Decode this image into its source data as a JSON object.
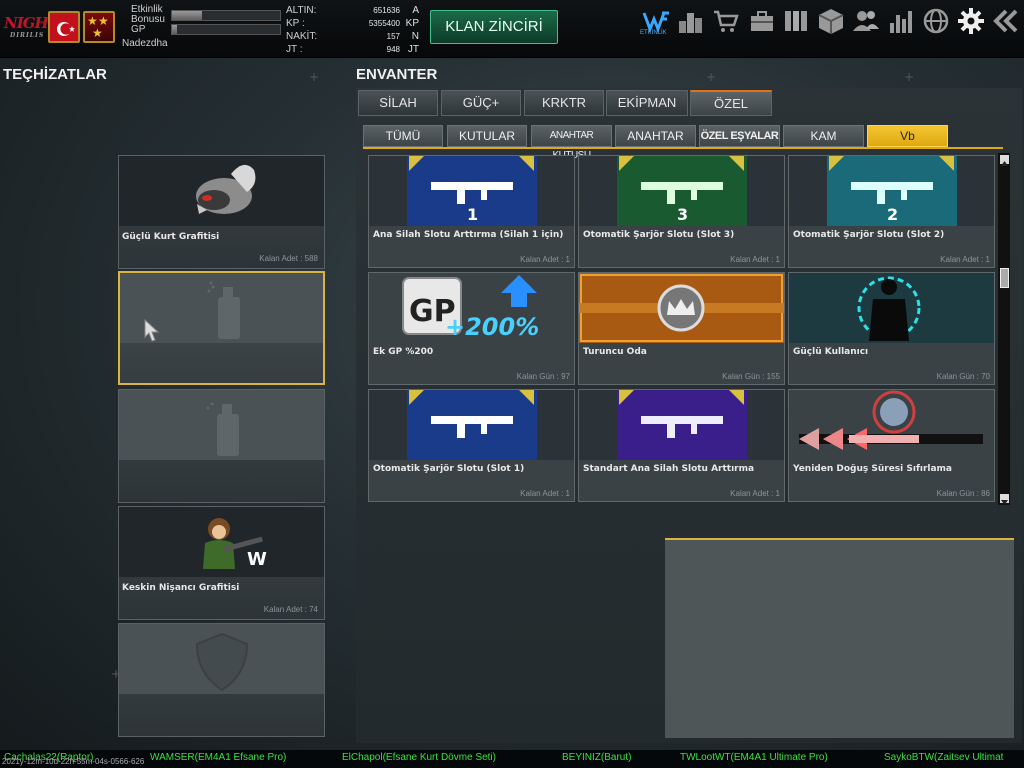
{
  "header": {
    "logo_text": "NIGHT",
    "logo_sub": "DIRILIS",
    "event_bonus_label": "Etkinlik Bonusu",
    "gp_label": "GP",
    "event_bonus_progress": 0.28,
    "gp_progress": 0.05,
    "nickname": "Nadezdha",
    "currency": [
      {
        "name": "ALTIN:",
        "value": "651636",
        "unit": "A"
      },
      {
        "name": "KP  :",
        "value": "5355400",
        "unit": "KP"
      },
      {
        "name": "NAKİT:",
        "value": "157",
        "unit": "N"
      },
      {
        "name": "JT   :",
        "value": "948",
        "unit": "JT"
      }
    ],
    "klan_button": "KLAN ZİNCİRİ",
    "event_icon_label": "ETKİNLİK",
    "icons": [
      "event-icon",
      "ranking-icon",
      "shop-cart-icon",
      "briefcase-icon",
      "cards-icon",
      "box-icon",
      "users-icon",
      "stats-icon",
      "globe-icon",
      "settings-icon",
      "back-icon"
    ]
  },
  "left_panel": {
    "title": "TEÇHİZATLAR",
    "slots": [
      {
        "name": "Güçlü Kurt Grafitisi",
        "qty": "Kalan Adet : 588"
      },
      {
        "name": "",
        "qty": ""
      },
      {
        "name": "",
        "qty": ""
      },
      {
        "name": "Keskin Nişancı Grafitisi",
        "qty": "Kalan Adet : 74"
      },
      {
        "name": "",
        "qty": ""
      }
    ]
  },
  "inventory": {
    "title": "ENVANTER",
    "tabs": [
      "SİLAH",
      "GÜÇ+",
      "KRKTR",
      "EKİPMAN",
      "ÖZEL"
    ],
    "subtabs": [
      "TÜMÜ",
      "KUTULAR",
      "ANAHTAR KUTUSU",
      "ANAHTAR",
      "ÖZEL EŞYALAR",
      "KAM",
      "Vb"
    ],
    "cards": [
      {
        "name": "Ana Silah Slotu Arttırma (Silah 1 için)",
        "qty": "Kalan Adet : 1",
        "badge": "1"
      },
      {
        "name": "Otomatik Şarjör Slotu (Slot 3)",
        "qty": "Kalan Adet : 1",
        "badge": "3"
      },
      {
        "name": "Otomatik Şarjör Slotu (Slot 2)",
        "qty": "Kalan Adet : 1",
        "badge": "2"
      },
      {
        "name": "Ek GP %200",
        "qty": "Kalan Gün : 97",
        "badge": "+200%"
      },
      {
        "name": "Turuncu Oda",
        "qty": "Kalan Gün : 155",
        "badge": ""
      },
      {
        "name": "Güçlü Kullanıcı",
        "qty": "Kalan Gün : 70",
        "badge": ""
      },
      {
        "name": "Otomatik Şarjör Slotu (Slot 1)",
        "qty": "Kalan Adet : 1",
        "badge": ""
      },
      {
        "name": "Standart Ana Silah Slotu Arttırma",
        "qty": "Kalan Adet : 1",
        "badge": ""
      },
      {
        "name": "Yeniden Doğuş Süresi Sıfırlama",
        "qty": "Kalan Gün : 86",
        "badge": ""
      }
    ]
  },
  "ticker": [
    "Cachalas22(Raptor)",
    "WAMSER(EM4A1 Efsane Pro)",
    "ElChapol(Efsane Kurt Dövme Seti)",
    "BEYINIZ(Barut)",
    "TWLootWT(EM4A1 Ultimate Pro)",
    "SaykoBTW(Zaitsev Ultimat"
  ],
  "timestamp": "2021y-12m-10d-22h-55m-04s-0566-626",
  "colors": {
    "accent": "#e0a812",
    "ticker": "#3ae040",
    "klan": "#1d6b4a"
  }
}
